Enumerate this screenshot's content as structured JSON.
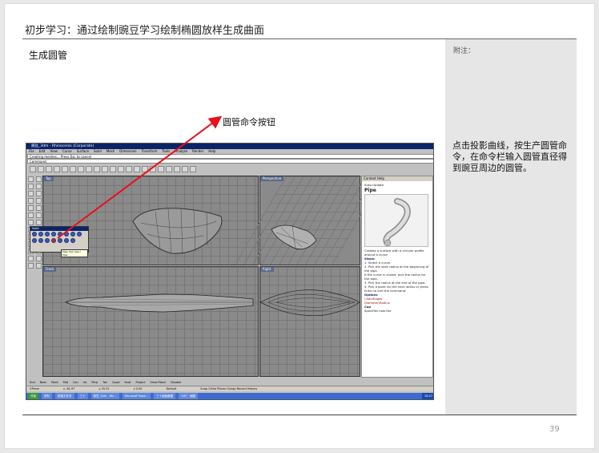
{
  "slide": {
    "title": "初步学习：通过绘制豌豆学习绘制椭圆放样生成曲面",
    "subtitle": "生成圆管",
    "note_label": "附注：",
    "description": "点击投影曲线，按生产圆管命令，在命令栏输入圆管直径得到豌豆周边的圆管。",
    "callout": "圆管命令按钮",
    "page_number": "39"
  },
  "rhino": {
    "window_title": "豌豆_3dm - Rhinoceros (Corporate)",
    "menu": [
      "File",
      "Edit",
      "View",
      "Curve",
      "Surface",
      "Solid",
      "Mesh",
      "Dimension",
      "Transform",
      "Tools",
      "Analyze",
      "Render",
      "Help"
    ],
    "command_history": "Creating meshes... Press Esc to cancel",
    "command_prompt": "Command:",
    "viewports": {
      "top": "Top",
      "perspective": "Perspective",
      "front": "Front",
      "right": "Right"
    },
    "popup_title": "Solid",
    "tooltip": "Pipe, flat caps / Pipe",
    "panel": {
      "header": "Context Help",
      "auto_update": "Auto-Update",
      "command": "Pipe",
      "intro": "Creates a surface with a circular profile around a curve.",
      "steps_heading": "Steps:",
      "step1": "1. Select a curve.",
      "step2": "2. Pick the start radius at the beginning of the pipe.",
      "step2b": "If the curve is closed, pick the radius for the pipe.",
      "step3": "3. Pick the radius at the end of the pipe.",
      "step4": "4. Pick a point for the next radius or press Enter to end the command.",
      "options_heading": "Options",
      "opt1": "ChainEdges",
      "opt2": "Diameter/Radius",
      "opt3": "Cap",
      "opt3_desc": "Specifies how the"
    },
    "osnaps": [
      "End",
      "Near",
      "Point",
      "Mid",
      "Cen",
      "Int",
      "Perp",
      "Tan",
      "Quad",
      "Knot",
      "Project",
      "SmartTrack",
      "Disable"
    ],
    "status": {
      "cplane": "CPlane",
      "x": "x -61.97",
      "y": "y 25.51",
      "z": "z 0.00",
      "layer": "Default",
      "modes": "Snap  Ortho  Planar  Osnap  Record History"
    },
    "taskbar": [
      "开始",
      "资料",
      "新建文件夹",
      "三十",
      "豌豆_3dm - Rhi...",
      "Microsoft Powe...",
      "三十画板截图",
      "Y:\\P) · 画图"
    ],
    "clock": "16:47"
  },
  "colors": {
    "arrow": "#e8101a",
    "note_panel": "#e6e6e6",
    "rhino_title": "#0a246a"
  }
}
